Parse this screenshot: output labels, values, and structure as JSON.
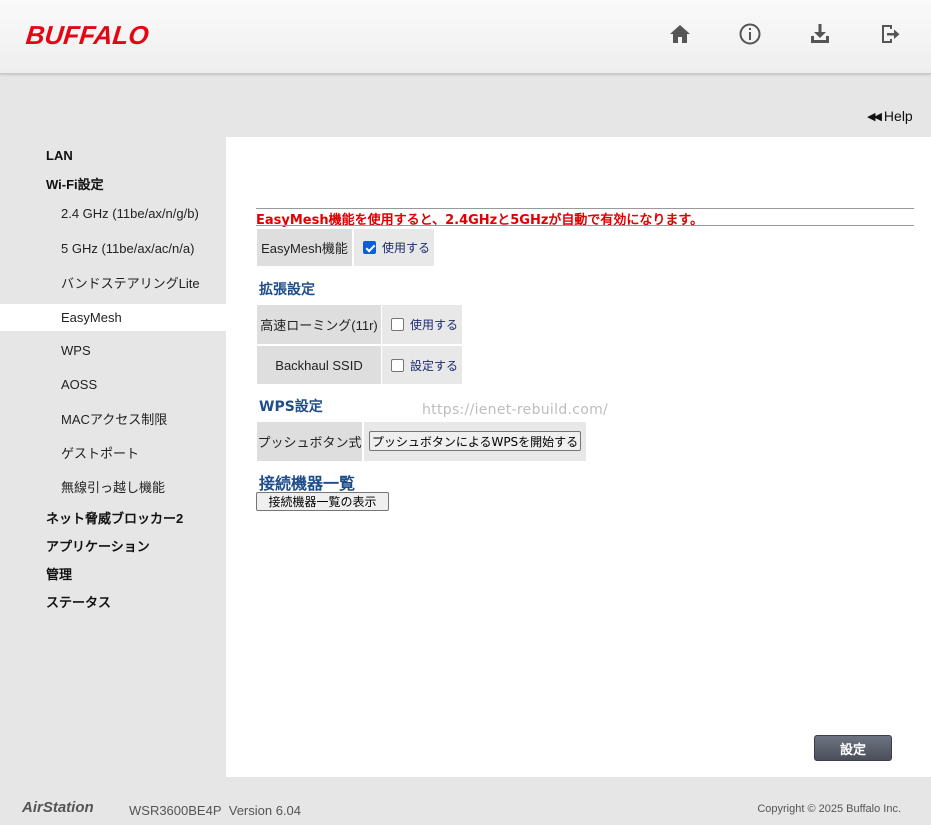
{
  "header": {
    "logo": "BUFFALO",
    "brand_color": "#e30613",
    "icons": [
      "home-icon",
      "info-icon",
      "download-icon",
      "logout-icon"
    ]
  },
  "help": {
    "label": "Help"
  },
  "sidebar": {
    "items": [
      {
        "label": "LAN",
        "level": "top",
        "active": false
      },
      {
        "label": "Wi-Fi設定",
        "level": "top",
        "active": false
      },
      {
        "label": "2.4 GHz (11be/ax/n/g/b)",
        "level": "sub",
        "active": false
      },
      {
        "label": "5 GHz (11be/ax/ac/n/a)",
        "level": "sub",
        "active": false
      },
      {
        "label": "バンドステアリングLite",
        "level": "sub",
        "active": false
      },
      {
        "label": "EasyMesh",
        "level": "sub",
        "active": true
      },
      {
        "label": "WPS",
        "level": "sub",
        "active": false
      },
      {
        "label": "AOSS",
        "level": "sub",
        "active": false
      },
      {
        "label": "MACアクセス制限",
        "level": "sub",
        "active": false
      },
      {
        "label": "ゲストポート",
        "level": "sub",
        "active": false
      },
      {
        "label": "無線引っ越し機能",
        "level": "sub",
        "active": false
      },
      {
        "label": "ネット脅威ブロッカー2",
        "level": "top",
        "active": false
      },
      {
        "label": "アプリケーション",
        "level": "top",
        "active": false
      },
      {
        "label": "管理",
        "level": "top",
        "active": false
      },
      {
        "label": "ステータス",
        "level": "top",
        "active": false
      }
    ]
  },
  "main": {
    "notice": "EasyMesh機能を使用すると、2.4GHzと5GHzが自動で有効になります。",
    "easymesh": {
      "label": "EasyMesh機能",
      "option": "使用する",
      "checked": true
    },
    "extended": {
      "title": "拡張設定",
      "fast_roaming": {
        "label": "高速ローミング(11r)",
        "option": "使用する",
        "checked": false
      },
      "backhaul_ssid": {
        "label": "Backhaul SSID",
        "option": "設定する",
        "checked": false
      }
    },
    "wps": {
      "title": "WPS設定",
      "push_label": "プッシュボタン式",
      "push_button": "プッシュボタンによるWPSを開始する"
    },
    "devices": {
      "title": "接続機器一覧",
      "button": "接続機器一覧の表示"
    },
    "watermark": "https://ienet-rebuild.com/",
    "save_button": "設定"
  },
  "footer": {
    "brand": "AirStation",
    "model": "WSR3600BE4P",
    "version": "Version 6.04",
    "copyright": "Copyright © 2025 Buffalo Inc."
  }
}
